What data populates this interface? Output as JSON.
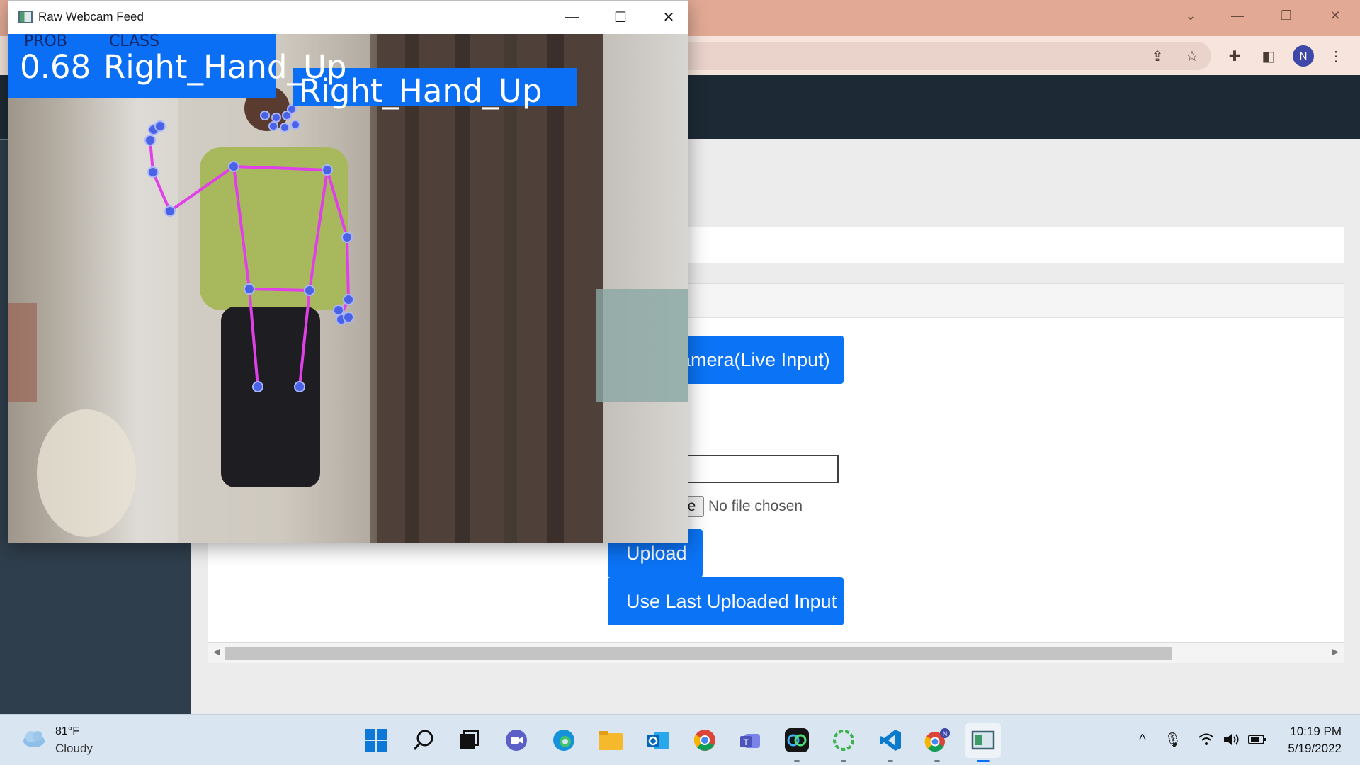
{
  "webcam_window": {
    "title": "Raw Webcam Feed",
    "overlay": {
      "prob_header": "PROB",
      "class_header": "CLASS",
      "prob_value": "0.68",
      "class_value": "Right_Hand_Up",
      "pose_label": "Right_Hand_Up"
    },
    "pose_color": "#e040e8",
    "landmark_color": "#4a62e6"
  },
  "browser": {
    "profile_initial": "N",
    "accent": "#e2aa95"
  },
  "page": {
    "camera_button": "Use Camera(Live Input)",
    "file_button_fragment": "e",
    "file_status": "No file chosen",
    "upload_button": "Upload",
    "last_input_button": "Use Last Uploaded Input",
    "button_color": "#0b73f5"
  },
  "taskbar": {
    "weather": {
      "temp": "81°F",
      "desc": "Cloudy"
    },
    "apps": [
      "start-icon",
      "search-icon",
      "task-view-icon",
      "chat-icon",
      "edge-icon",
      "file-explorer-icon",
      "outlook-icon",
      "chrome-icon",
      "teams-icon",
      "webex-icon",
      "spinner-app-icon",
      "vscode-icon",
      "chrome-profile-icon",
      "webcam-feed-icon"
    ],
    "clock": {
      "time": "10:19 PM",
      "date": "5/19/2022"
    }
  }
}
